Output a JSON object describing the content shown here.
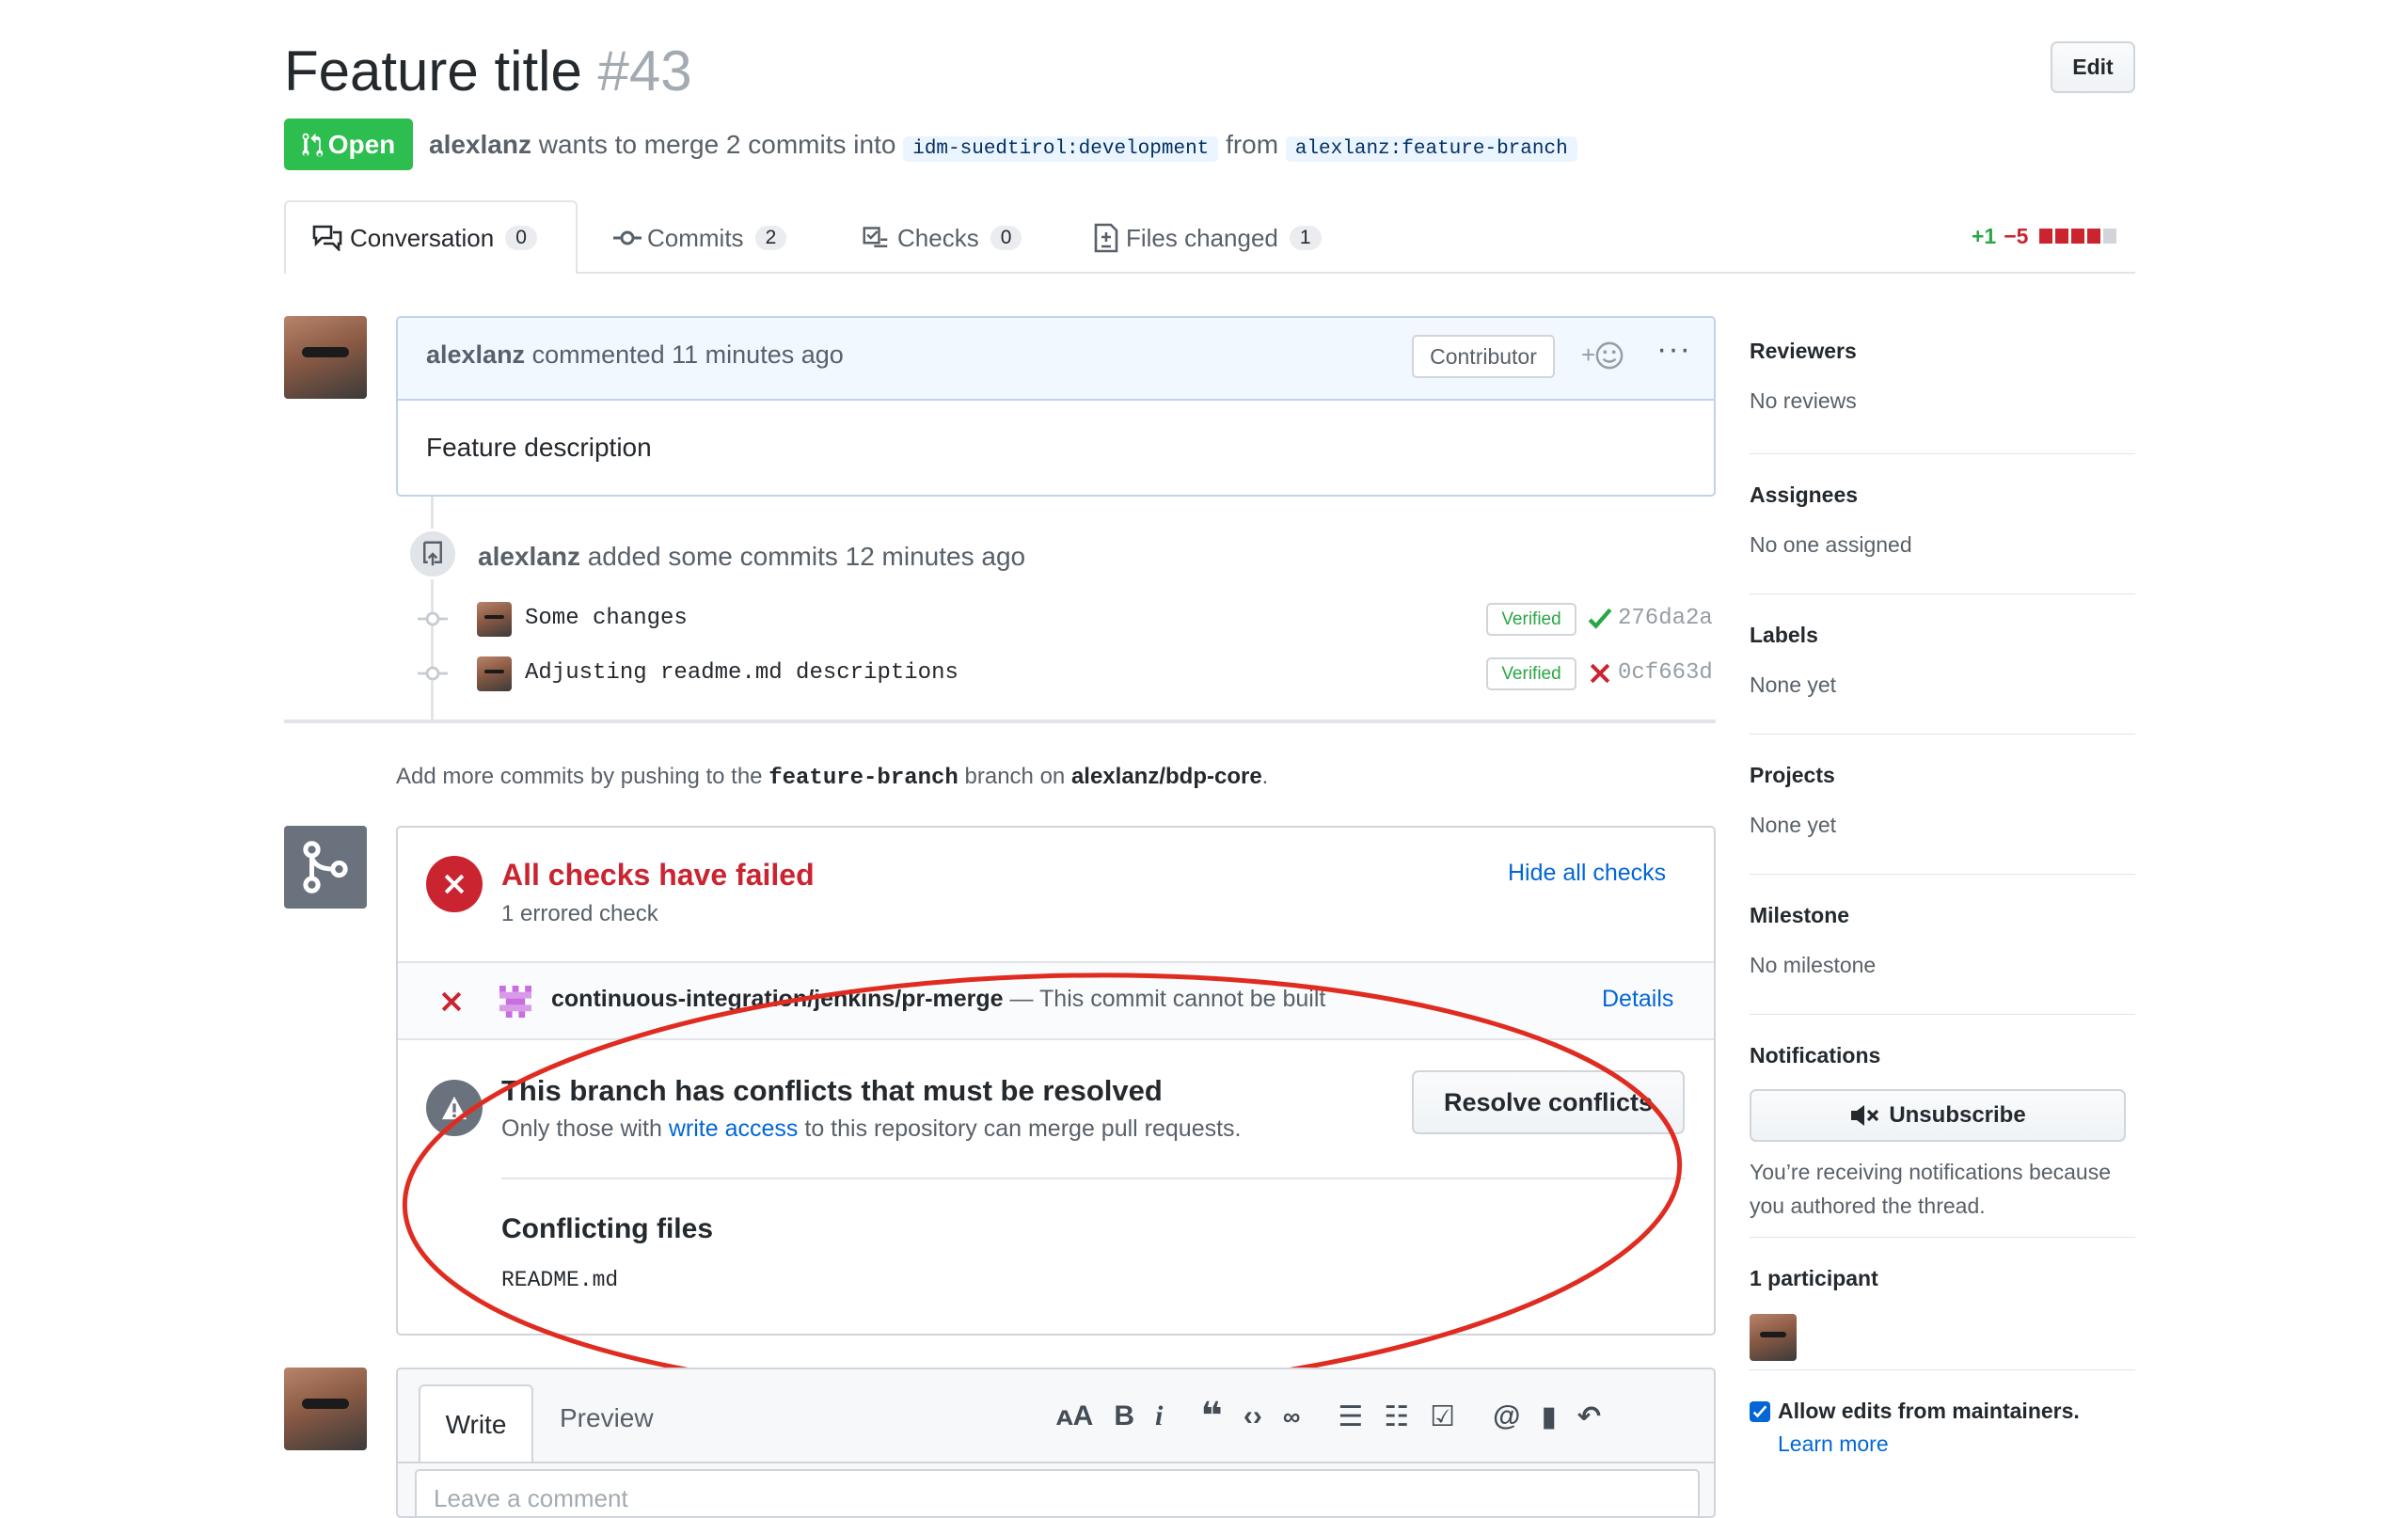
{
  "header": {
    "title": "Feature title",
    "number": "#43",
    "edit_label": "Edit",
    "state_label": "Open",
    "author": "alexlanz",
    "merge_text": "wants to merge 2 commits into",
    "base_branch": "idm-suedtirol:development",
    "from_text": "from",
    "head_branch": "alexlanz:feature-branch"
  },
  "tabs": [
    {
      "label": "Conversation",
      "count": "0",
      "icon": "comment-discussion-icon"
    },
    {
      "label": "Commits",
      "count": "2",
      "icon": "git-commit-icon"
    },
    {
      "label": "Checks",
      "count": "0",
      "icon": "checklist-icon"
    },
    {
      "label": "Files changed",
      "count": "1",
      "icon": "file-diff-icon"
    }
  ],
  "diffstat": {
    "additions": "+1",
    "deletions": "−5"
  },
  "comment": {
    "author": "alexlanz",
    "meta": "commented 11 minutes ago",
    "role_badge": "Contributor",
    "body": "Feature description"
  },
  "commits_event": {
    "author": "alexlanz",
    "text": "added some commits 12 minutes ago",
    "commits": [
      {
        "message": "Some changes",
        "verified": "Verified",
        "status": "success",
        "sha": "276da2a"
      },
      {
        "message": "Adjusting readme.md descriptions",
        "verified": "Verified",
        "status": "failure",
        "sha": "0cf663d"
      }
    ]
  },
  "push_hint": {
    "prefix": "Add more commits by pushing to the",
    "branch": "feature-branch",
    "middle": "branch on",
    "repo": "alexlanz/bdp-core",
    "suffix": "."
  },
  "merge_box": {
    "checks_title": "All checks have failed",
    "checks_sub": "1 errored check",
    "hide_checks": "Hide all checks",
    "check_name": "continuous-integration/jenkins/pr-merge",
    "check_desc": "— This commit cannot be built",
    "details": "Details",
    "conflict_title": "This branch has conflicts that must be resolved",
    "conflict_sub_prefix": "Only those with",
    "conflict_sub_link": "write access",
    "conflict_sub_suffix": "to this repository can merge pull requests.",
    "resolve_label": "Resolve conflicts",
    "conflicting_heading": "Conflicting files",
    "conflicting_file": "README.md"
  },
  "editor": {
    "write_tab": "Write",
    "preview_tab": "Preview",
    "placeholder": "Leave a comment"
  },
  "sidebar": {
    "reviewers": {
      "heading": "Reviewers",
      "value": "No reviews"
    },
    "assignees": {
      "heading": "Assignees",
      "value": "No one assigned"
    },
    "labels": {
      "heading": "Labels",
      "value": "None yet"
    },
    "projects": {
      "heading": "Projects",
      "value": "None yet"
    },
    "milestone": {
      "heading": "Milestone",
      "value": "No milestone"
    },
    "notifications": {
      "heading": "Notifications",
      "button": "Unsubscribe",
      "reason": "You’re receiving notifications because you authored the thread."
    },
    "participants": {
      "heading": "1 participant"
    },
    "allow_edits": {
      "label": "Allow edits from maintainers.",
      "learn_more": "Learn more"
    }
  },
  "colors": {
    "open_green": "#2cbe4e",
    "failure_red": "#cb2431",
    "success_green": "#28a745",
    "link_blue": "#0366d6",
    "annotation_red": "#e02b20"
  }
}
